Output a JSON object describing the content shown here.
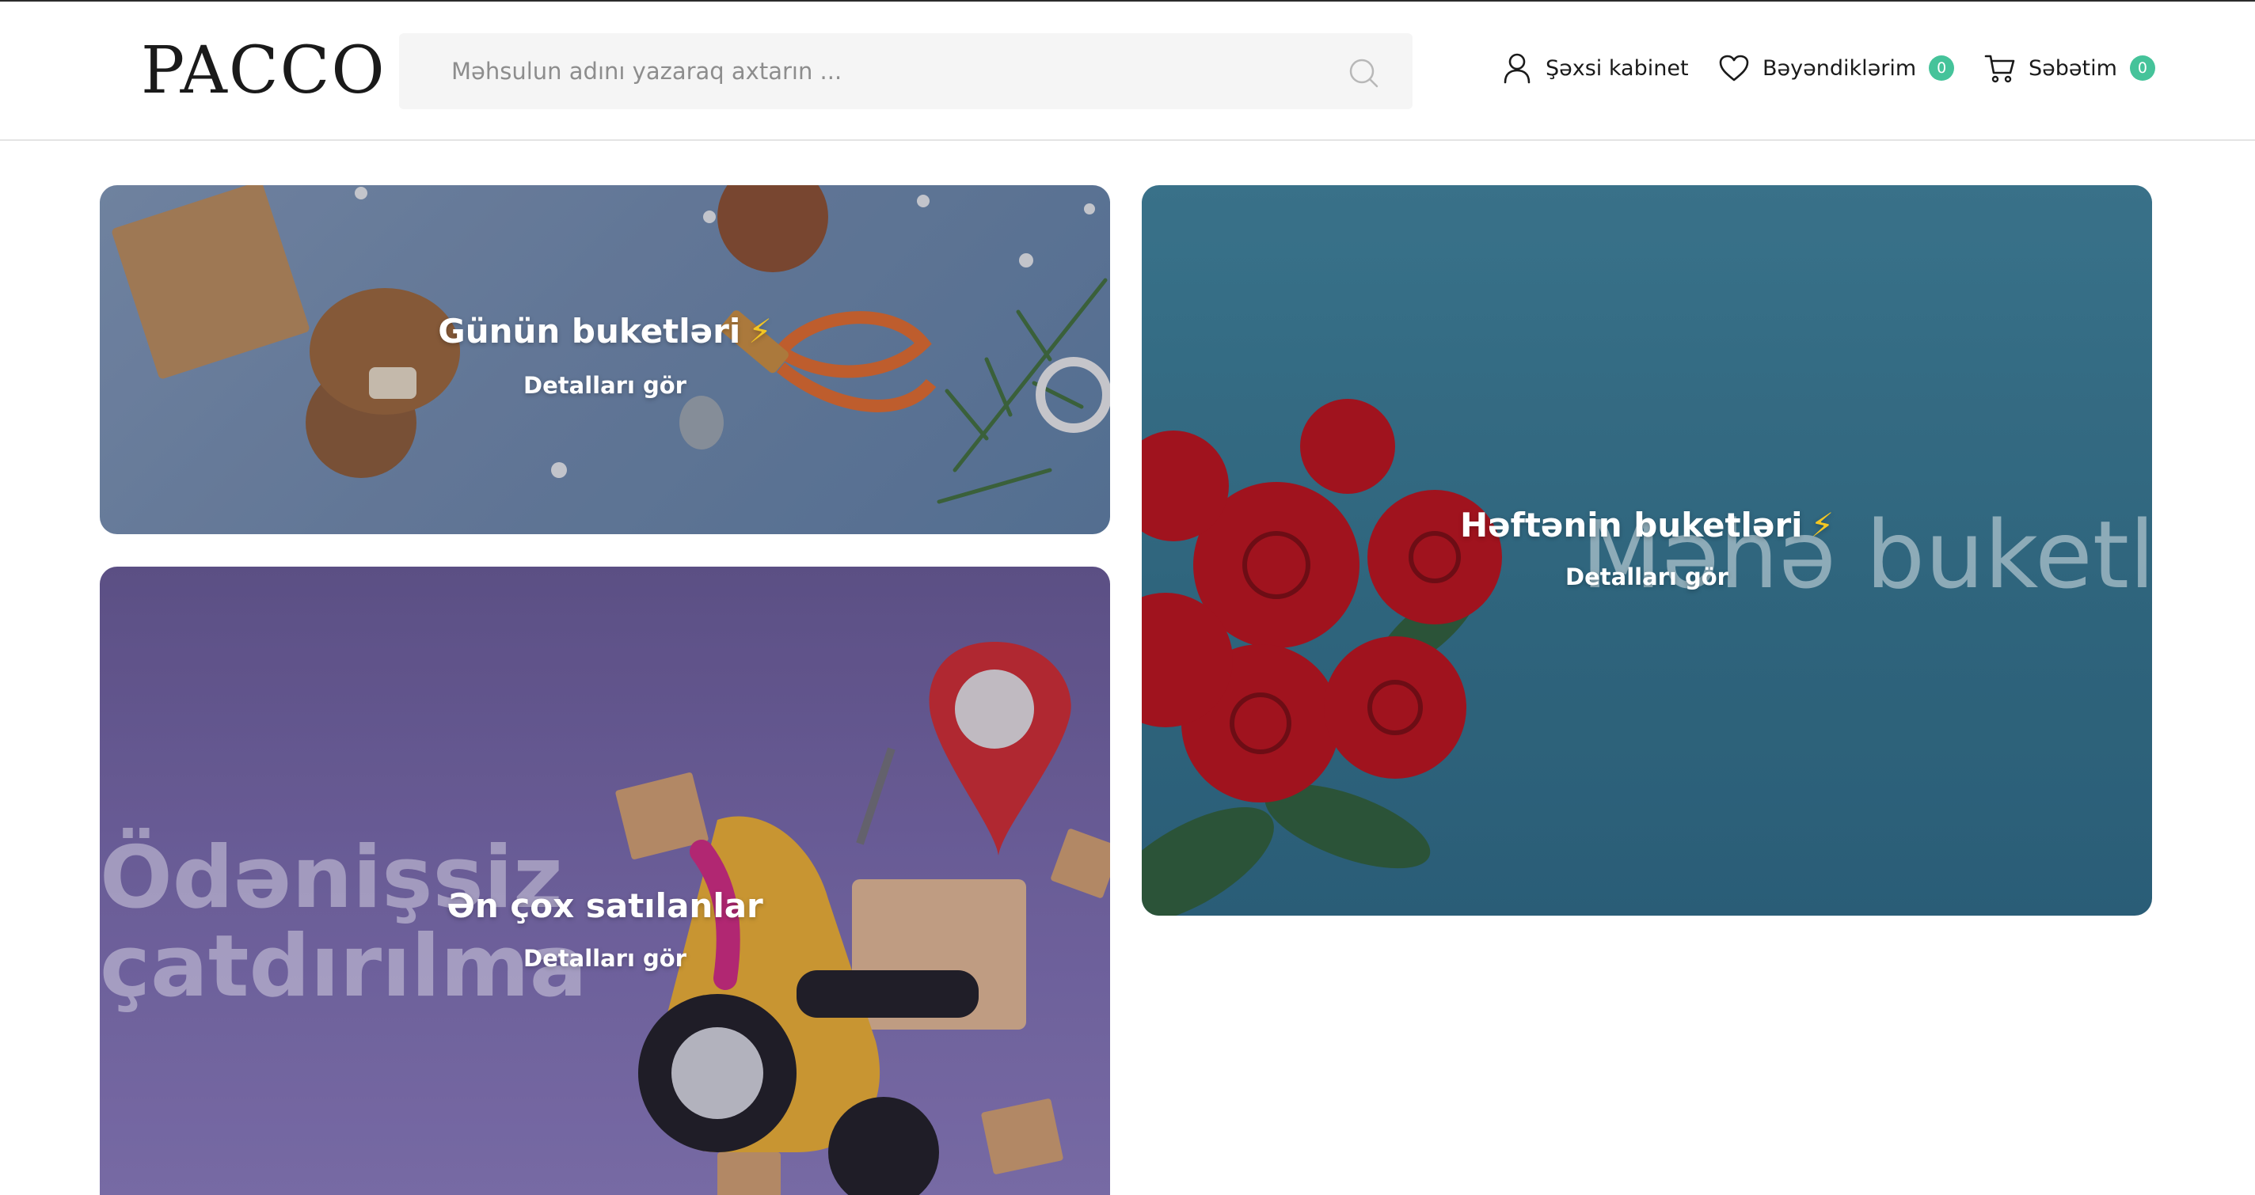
{
  "header": {
    "logo_text": "PACCO",
    "search_placeholder": "Məhsulun adını yazaraq axtarın ...",
    "account_label": "Şəxsi kabinet",
    "favorites_label": "Bəyəndiklərim",
    "favorites_count": "0",
    "cart_label": "Səbətim",
    "cart_count": "0",
    "accent_color": "#45c39a"
  },
  "banners": [
    {
      "title": "Günün buketləri",
      "title_icon": "lightning-icon",
      "link": "Detalları gör"
    },
    {
      "title": "Həftənin buketləri",
      "title_icon": "lightning-icon",
      "link": "Detalları gör",
      "background_text": "Məhə buketlə"
    },
    {
      "title": "Ən çox satılanlar",
      "link": "Detalları gör",
      "background_text_line1": "Ödənişsiz",
      "background_text_line2": "çatdırılma"
    }
  ]
}
